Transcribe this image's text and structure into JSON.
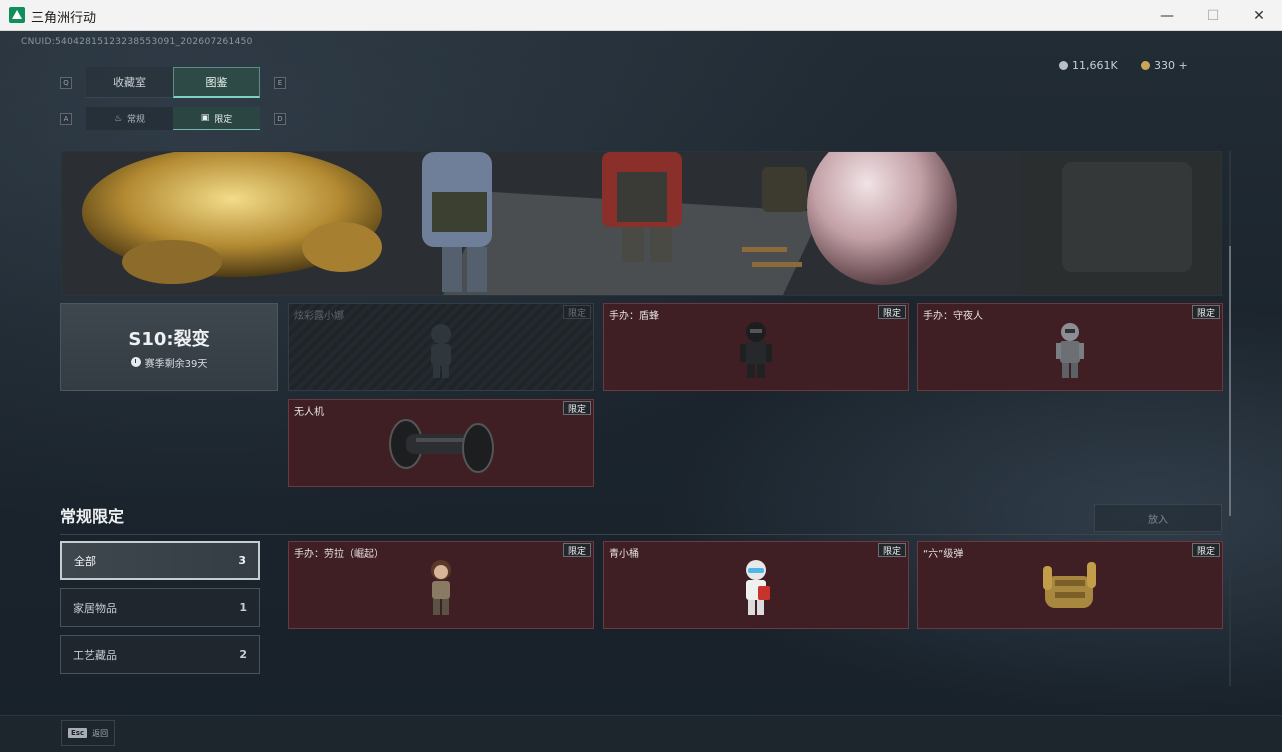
{
  "window": {
    "title": "三角洲行动",
    "minimize_symbol": "—",
    "maximize_symbol": "☐",
    "close_symbol": "✕"
  },
  "header": {
    "uid": "CNUID:54042815123238553091_202607261450",
    "currency": [
      {
        "icon": "silver-coin-icon",
        "value": "11,661K"
      },
      {
        "icon": "gold-coin-icon",
        "value": "330 +"
      }
    ]
  },
  "tabs": {
    "left_key": "Q",
    "right_key": "E",
    "items": [
      {
        "label": "收藏室",
        "active": false
      },
      {
        "label": "图鉴",
        "active": true
      }
    ]
  },
  "subtabs": {
    "left_key": "A",
    "right_key": "D",
    "items": [
      {
        "icon": "flame-icon",
        "label": "常规",
        "active": false
      },
      {
        "icon": "image-icon",
        "label": "限定",
        "active": true
      }
    ]
  },
  "season": {
    "title": "S10:裂变",
    "remaining": "赛季剩余39天"
  },
  "season_items": [
    {
      "name": "炫彩露小娜",
      "badge": "限定",
      "locked": true
    },
    {
      "name": "手办：盾蜂",
      "badge": "限定",
      "locked": false
    },
    {
      "name": "手办：守夜人",
      "badge": "限定",
      "locked": false
    },
    {
      "name": "无人机",
      "badge": "限定",
      "locked": false
    }
  ],
  "section": {
    "title": "常规限定",
    "zoom_label": "放入"
  },
  "filters": [
    {
      "label": "全部",
      "count": "3",
      "active": true
    },
    {
      "label": "家居物品",
      "count": "1",
      "active": false
    },
    {
      "label": "工艺藏品",
      "count": "2",
      "active": false
    }
  ],
  "regular_items": [
    {
      "name": "手办：劳拉（崛起）",
      "badge": "限定"
    },
    {
      "name": "青小桶",
      "badge": "限定"
    },
    {
      "name": "“六”级弹",
      "badge": "限定"
    }
  ],
  "footer": {
    "esc_key": "Esc",
    "esc_label": "返回"
  },
  "colors": {
    "accent_teal": "#7fd0c0",
    "card_red": "#3f1f24",
    "background": "#1b232b"
  }
}
